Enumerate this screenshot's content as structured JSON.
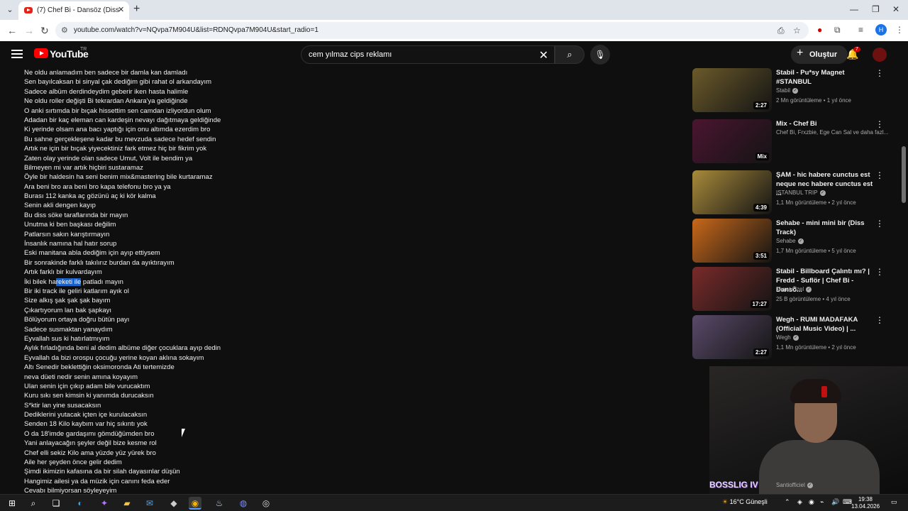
{
  "browser": {
    "tab_title": "(7) Chef Bi - Dansöz (Diss Stabil)",
    "url": "youtube.com/watch?v=NQvpa7M904U&list=RDNQvpa7M904U&start_radio=1",
    "profile_initial": "H"
  },
  "youtube": {
    "logo_text": "YouTube",
    "country_code": "TR",
    "search_value": "cem yılmaz cips reklamı",
    "create_label": "Oluştur",
    "notification_count": "7"
  },
  "lyrics": [
    "Ne oldu anlamadım ben sadece bir damla kan damladı",
    "Sen bayılcaksan bi sinyal çak dediğim gibi rahat ol arkandayım",
    "Sadece albüm derdindeydim geberir iken hasta halimle",
    "Ne oldu roller değişti Bi tekrardan Ankara'ya geldiğinde",
    "O anki sırtımda bir bıçak hissettim sen camdan izliyordun olum",
    "Adadan bir kaç eleman can kardeşin nevayı dağıtmaya geldiğinde",
    "Ki yerinde olsam ana bacı yaptığı için onu altımda ezerdim bro",
    "Bu sahne gerçekleşene kadar bu mevzuda sadece hedef sendin",
    "Artık ne için bir bıçak yiyecektiniz fark etmez hiç bir fikrim yok",
    "Zaten olay yerinde olan sadece Umut, Volt ile bendim ya",
    "Bilmeyen mi var artık hiçbiri sustaramaz",
    "Öyle bir haldesin ha seni benim mix&mastering bile kurtaramaz",
    "Ara beni bro ara beni bro kapa telefonu bro ya ya",
    "Burası 112 kanka aç gözünü aç ki kör kalma",
    "Senin akli dengen kayıp",
    "Bu diss söke taraflarında bir mayın",
    "Unutma ki ben başkası değilim",
    "Patlarsın sakın karıştırmayın",
    "İnsanlık namına hal hatır sorup",
    "Eski manitana abla dediğim için ayıp ettiysem",
    "Bir sonrakinde farklı takılırız burdan da ayıktırayım",
    "Artık farklı bir kulvardayım",
    "İki bilek hareketi ile patladı mayın",
    "Bir iki track ile geliri katlarım ayık ol",
    "Size alkış şak şak şak bayım",
    "Çıkartıyorum lan bak şapkayı",
    "Bölüyorum ortaya doğru bütün payı",
    "Sadece susmaktan yanaydım",
    "Eyvallah sus ki hatırlatmıyım",
    "Aylık fırladığında beni al dedim albüme diğer çocuklara ayıp dedin",
    "Eyvallah da bizi orospu çocuğu yerine koyan aklına sokayım",
    "Altı Senedir beklettiğin oksimoronda Ati tertemizde",
    "neva düeti nedir senin amına koyayım",
    "Ulan senin için çıkıp adam bile vurucaktım",
    "Kuru sıkı sen kimsin ki yanımda durucaksın",
    "S*ktir lan yine susacaksın",
    "Dediklerini yutacak içten içe kurulacaksın",
    "Senden 18 Kilo kaybım var hiç sıkıntı yok",
    "O da 18'imde gardaşımı gömdüğümden bro",
    "Yani anlayacağın şeyler değil bize kesme rol",
    "Chef elli sekiz Kilo ama yüzde yüz yürek bro",
    "Aile her şeyden önce gelir dedim",
    "Şimdi ikimizin kafasına da bir silah dayasınlar düşün",
    "Hangimiz ailesi ya da müzik için canını feda eder",
    "Cevabı bilmiyorsan söyleyeyim"
  ],
  "highlight": {
    "before": "İki bilek ha",
    "selected": "reketi ile",
    "after": " patladı mayın"
  },
  "sidebar": [
    {
      "title": "Stabil - Pu*sy Magnet #STANBUL",
      "channel": "Stabil",
      "verified": true,
      "meta": "2 Mn görüntüleme • 1 yıl önce",
      "duration": "2:27",
      "thumb": "#6b5a2a"
    },
    {
      "title": "Mix - Chef Bi",
      "channel": "Chef Bi, Frxzbie, Ege Can Sal ve daha fazl...",
      "verified": false,
      "meta": "",
      "duration": "Mix",
      "thumb": "#4a1530"
    },
    {
      "title": "ŞAM - hic habere cunctus est neque nec habere cunctus est ...",
      "channel": "ISTANBUL TRIP",
      "verified": true,
      "meta": "1,1 Mn görüntüleme • 2 yıl önce",
      "duration": "4:39",
      "thumb": "#a88a3a"
    },
    {
      "title": "Sehabe - mini mini bir (Diss Track)",
      "channel": "Sehabe",
      "verified": true,
      "meta": "1,7 Mn görüntüleme • 5 yıl önce",
      "duration": "3:51",
      "thumb": "#c8681a"
    },
    {
      "title": "Stabil - Billboard Çalıntı mı? | Fredd - Suflör | Chef Bi - Danső...",
      "channel": "Murat Özel",
      "verified": true,
      "meta": "25 B görüntüleme • 4 yıl önce",
      "duration": "17:27",
      "thumb": "#7a2a2a"
    },
    {
      "title": "Wegh - RUMI MADAFAKA (Official Music Video) | ...",
      "channel": "Wegh",
      "verified": true,
      "meta": "1,1 Mn görüntüleme • 2 yıl önce",
      "duration": "2:27",
      "thumb": "#5a4a6a"
    }
  ],
  "webcam": {
    "overlay_text": "BOSSLIG IV",
    "channel_below": "Santiofficiel"
  },
  "taskbar": {
    "weather": "16°C  Güneşli",
    "time": "19:38",
    "date": "13.04.2026"
  }
}
